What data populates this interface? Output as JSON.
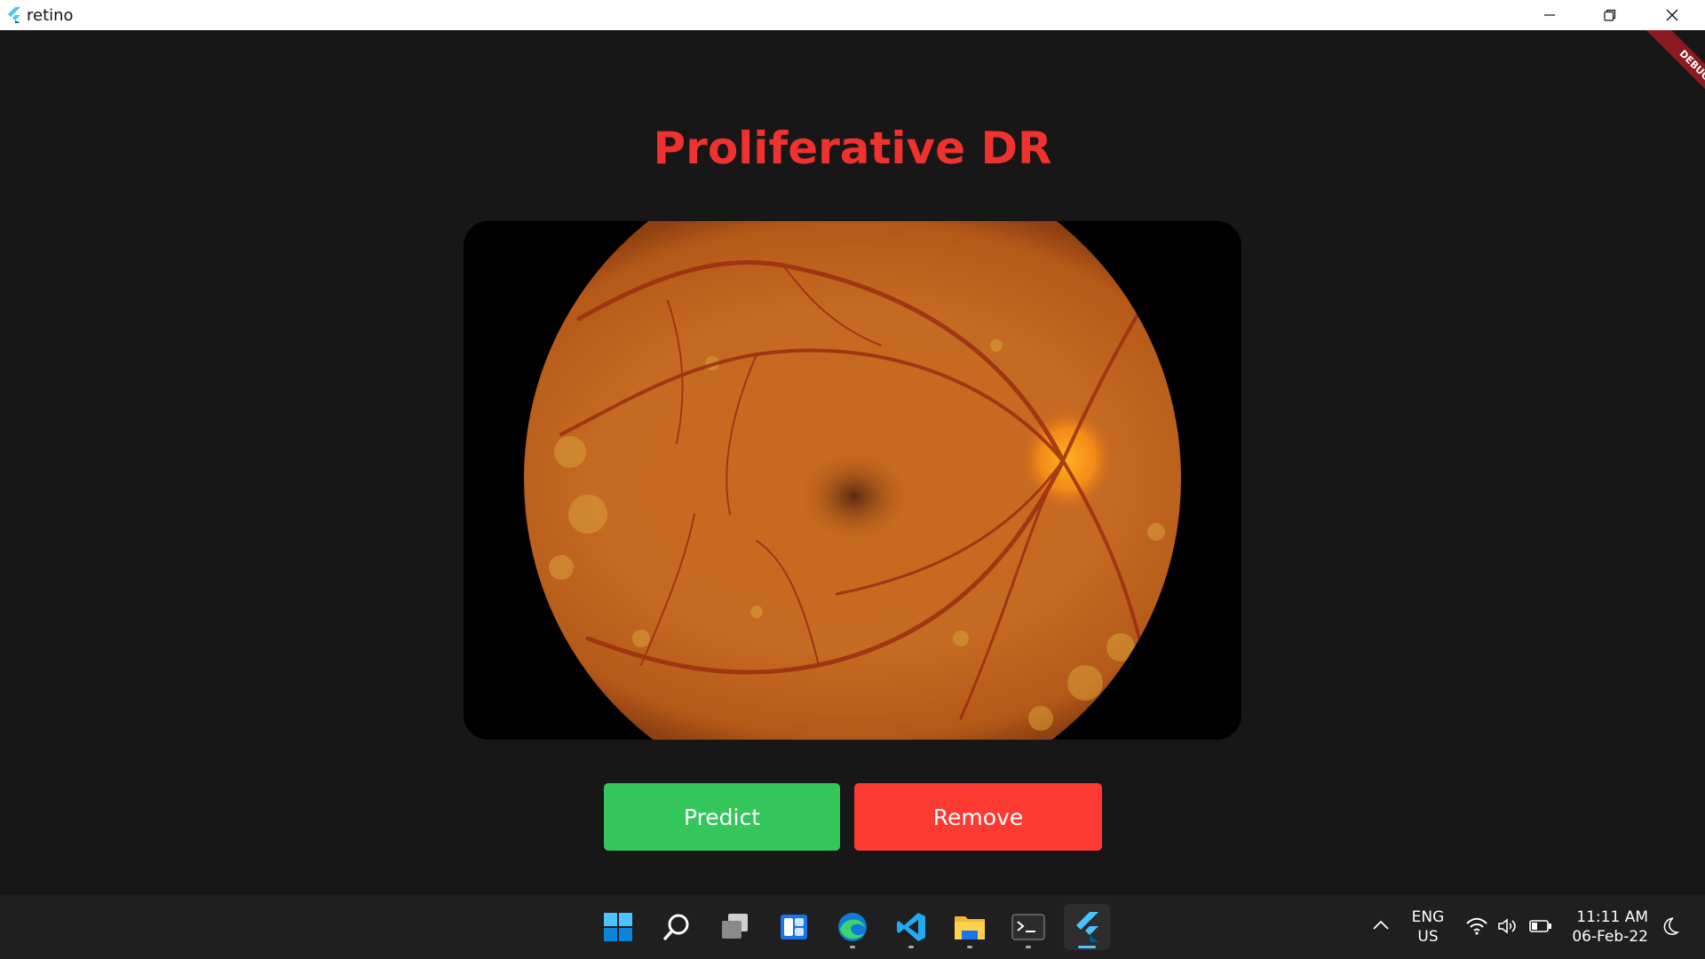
{
  "window": {
    "title": "retino"
  },
  "main": {
    "result_title": "Proliferative DR",
    "image_alt": "Retinal fundus image",
    "predict_label": "Predict",
    "remove_label": "Remove",
    "debug_label": "DEBUG"
  },
  "colors": {
    "title": "#f0322e",
    "predict": "#34c65a",
    "remove": "#fd3a31",
    "background": "#171717"
  },
  "taskbar": {
    "apps": [
      "start-icon",
      "search-icon",
      "task-view-icon",
      "widgets-icon",
      "edge-icon",
      "vscode-icon",
      "file-explorer-icon",
      "terminal-icon",
      "flutter-icon"
    ],
    "lang_line1": "ENG",
    "lang_line2": "US",
    "time": "11:11 AM",
    "date": "06-Feb-22"
  }
}
